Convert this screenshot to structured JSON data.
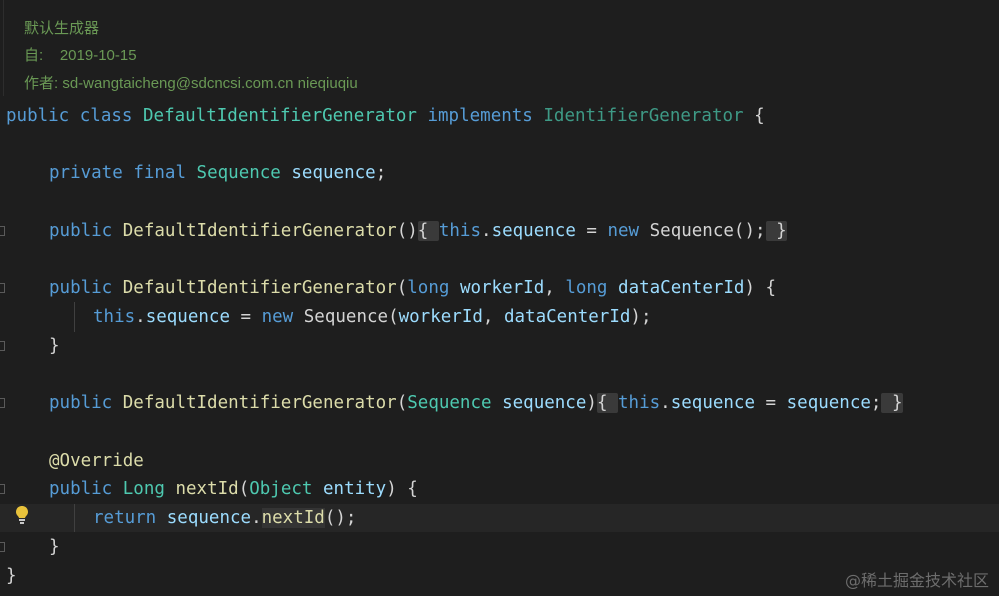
{
  "doc": {
    "line1": "默认生成器",
    "line2": "自:    2019-10-15",
    "line3": "作者: sd-wangtaicheng@sdcncsi.com.cn nieqiuqiu"
  },
  "code": {
    "l1": {
      "kw1": "public",
      "kw2": "class",
      "cls": "DefaultIdentifierGenerator",
      "kw3": "implements",
      "iface": "IdentifierGenerator",
      "brace": "{"
    },
    "l2": {
      "kw1": "private",
      "kw2": "final",
      "type": "Sequence",
      "field": "sequence",
      "semi": ";"
    },
    "l3": {
      "kw": "public",
      "fn": "DefaultIdentifierGenerator",
      "paren": "()",
      "folded": "{ ",
      "this": "this",
      "dot": ".",
      "field": "sequence",
      "eq": " = ",
      "new": "new",
      "ctor": "Sequence",
      "rest": "();",
      "close": " }"
    },
    "l4": {
      "kw": "public",
      "fn": "DefaultIdentifierGenerator",
      "open": "(",
      "t1": "long",
      "p1": "workerId",
      "comma": ", ",
      "t2": "long",
      "p2": "dataCenterId",
      "close": ") {"
    },
    "l5": {
      "this": "this",
      "dot": ".",
      "field": "sequence",
      "eq": " = ",
      "new": "new",
      "ctor": "Sequence",
      "open": "(",
      "a1": "workerId",
      "comma": ", ",
      "a2": "dataCenterId",
      "close": ");"
    },
    "l6": {
      "brace": "}"
    },
    "l7": {
      "kw": "public",
      "fn": "DefaultIdentifierGenerator",
      "open": "(",
      "type": "Sequence",
      "param": "sequence",
      "paren_close": ")",
      "folded": "{ ",
      "this": "this",
      "dot": ".",
      "field": "sequence",
      "eq": " = ",
      "val": "sequence",
      "semi": ";",
      "close": " }"
    },
    "l8": {
      "anno": "@Override"
    },
    "l9": {
      "kw": "public",
      "type": "Long",
      "fn": "nextId",
      "open": "(",
      "ptype": "Object",
      "param": "entity",
      "close": ") {"
    },
    "l10": {
      "kw": "return",
      "obj": "sequence",
      "dot": ".",
      "fn": "nextId",
      "rest": "();"
    },
    "l11": {
      "brace": "}"
    },
    "l12": {
      "brace": "}"
    }
  },
  "watermark": "@稀土掘金技术社区",
  "colors": {
    "keyword": "#569cd6",
    "type": "#4ec9b0",
    "function": "#dcdcaa",
    "variable": "#9cdcfe",
    "comment": "#6a9955",
    "background": "#1e1e1e"
  },
  "icons": {
    "bulb": "lightbulb-icon"
  }
}
